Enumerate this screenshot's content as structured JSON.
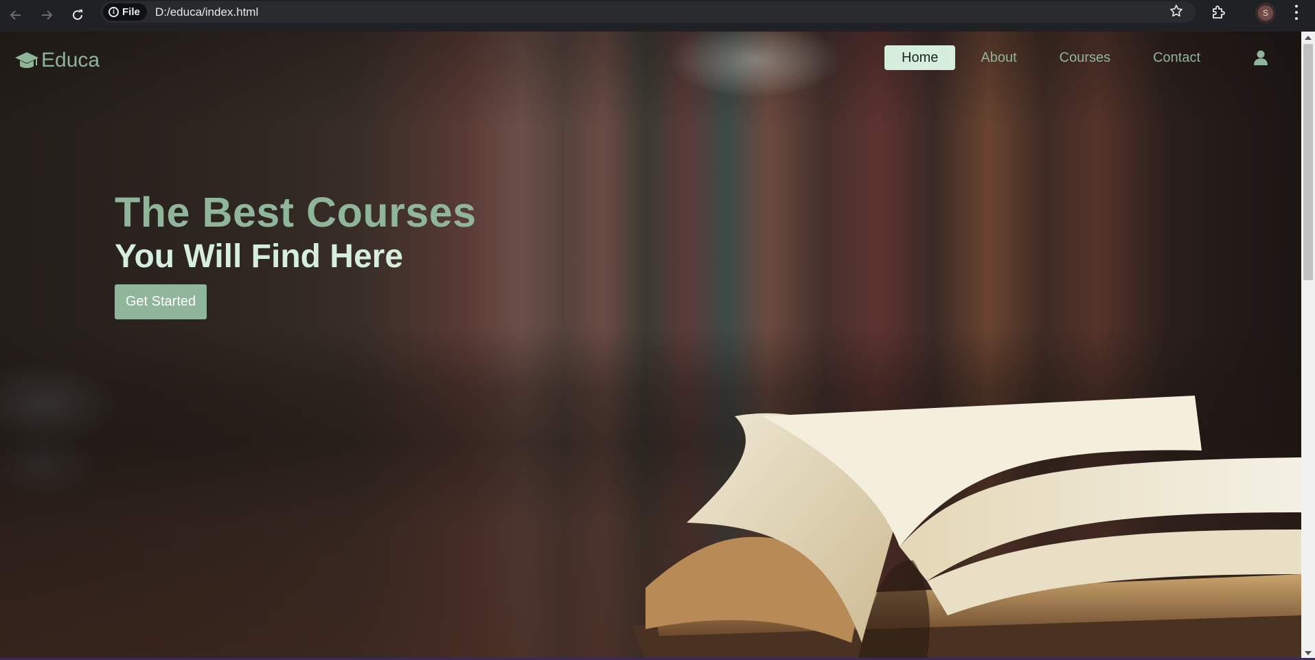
{
  "browser": {
    "file_chip_label": "File",
    "url": "D:/educa/index.html",
    "profile_initial": "S"
  },
  "site": {
    "logo_text": "Educa",
    "nav_items": [
      {
        "label": "Home",
        "active": true
      },
      {
        "label": "About",
        "active": false
      },
      {
        "label": "Courses",
        "active": false
      },
      {
        "label": "Contact",
        "active": false
      }
    ]
  },
  "hero": {
    "title": "The Best Courses",
    "subtitle": "You Will Find Here",
    "cta_label": "Get Started"
  },
  "colors": {
    "accent": "#8fb59a",
    "light_accent": "#d6eedd",
    "browser_chrome": "#202124"
  },
  "icons": {
    "logo": "graduation-cap-icon",
    "user": "user-icon",
    "back": "arrow-left-icon",
    "forward": "arrow-right-icon",
    "reload": "reload-icon",
    "info": "info-icon",
    "bookmark": "star-icon",
    "extensions": "puzzle-icon",
    "menu": "kebab-menu-icon"
  }
}
